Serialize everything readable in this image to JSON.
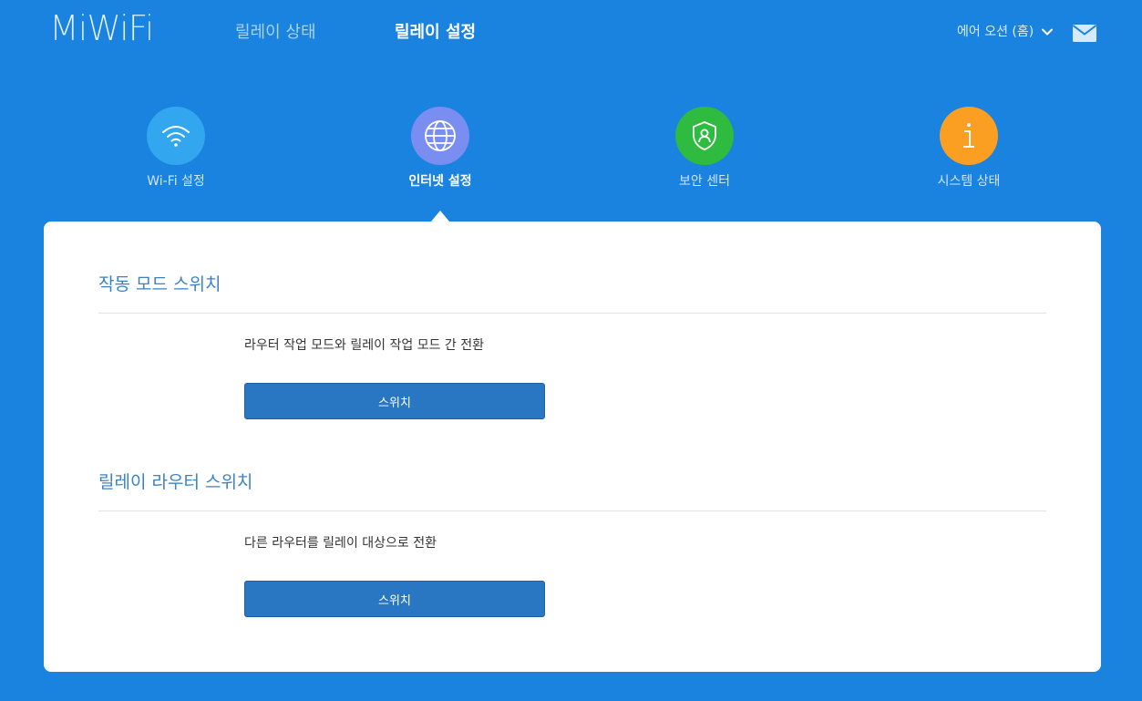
{
  "header": {
    "logo": "MiWiFi",
    "nav": {
      "relay_status": "릴레이 상태",
      "relay_settings": "릴레이 설정"
    },
    "account_name": "에어 오션 (홈)",
    "icons": {
      "account_dropdown": "chevron-down-icon",
      "messages": "mail-icon"
    }
  },
  "tiles": [
    {
      "label": "Wi-Fi 설정",
      "icon": "wifi-icon",
      "color": "#33a6f0",
      "active": false
    },
    {
      "label": "인터넷 설정",
      "icon": "globe-icon",
      "color": "#7a8df0",
      "active": true
    },
    {
      "label": "보안 센터",
      "icon": "shield-user-icon",
      "color": "#2fbb3f",
      "active": false
    },
    {
      "label": "시스템 상태",
      "icon": "info-icon",
      "color": "#fb9f22",
      "active": false
    }
  ],
  "sections": [
    {
      "title": "작동 모드 스위치",
      "description": "라우터 작업 모드와 릴레이 작업 모드 간 전환",
      "button_label": "스위치"
    },
    {
      "title": "릴레이 라우터 스위치",
      "description": "다른 라우터를 릴레이 대상으로 전환",
      "button_label": "스위치"
    }
  ],
  "colors": {
    "background": "#1983df",
    "panel": "#ffffff",
    "section_title": "#3b82c5",
    "button": "#2976c2"
  }
}
